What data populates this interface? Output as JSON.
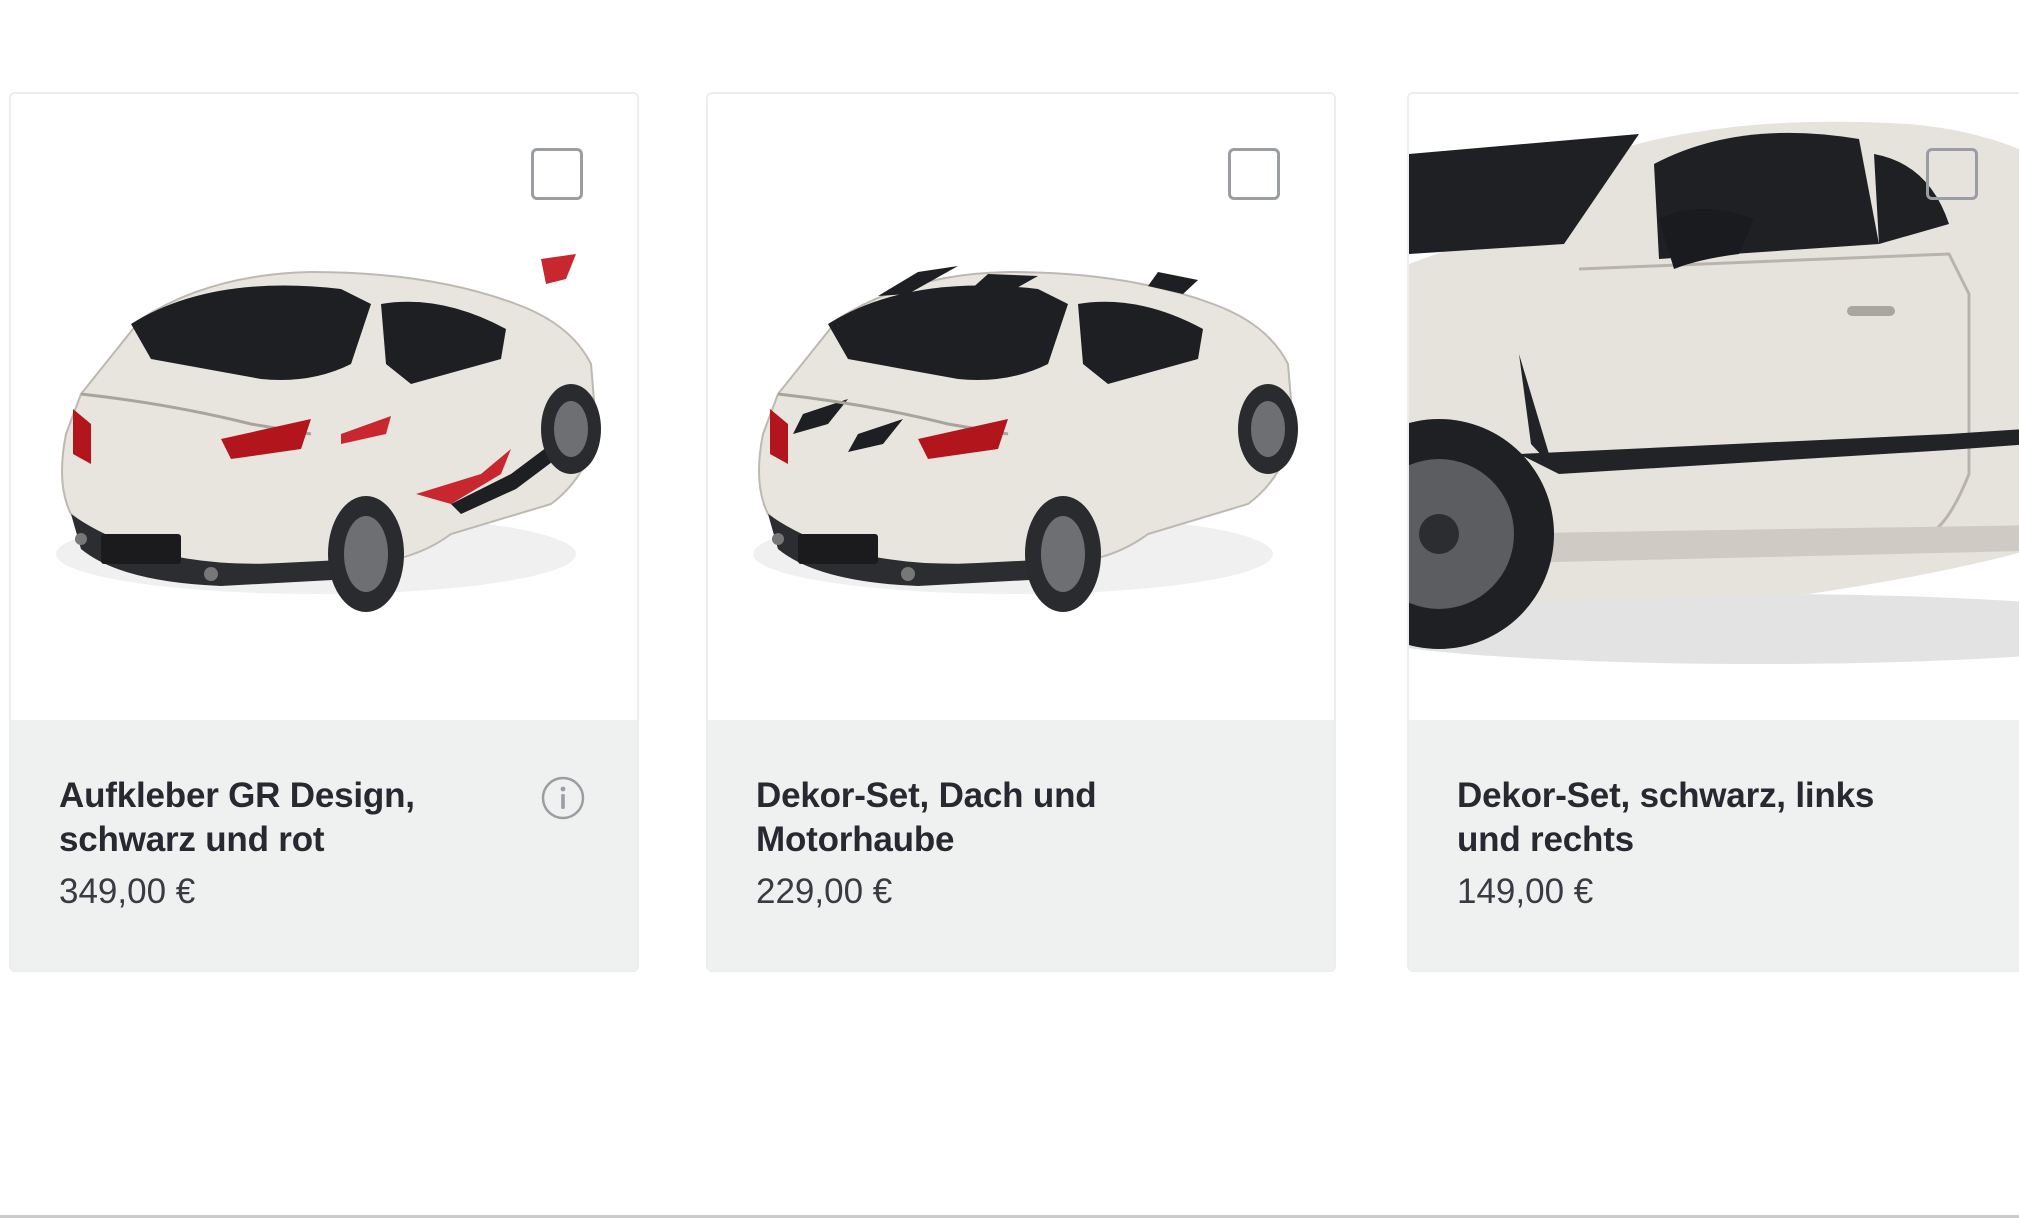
{
  "products": [
    {
      "title_line1": "Aufkleber GR Design,",
      "title_line2": "schwarz und rot",
      "price": "349,00 €",
      "has_info": true,
      "selected": false,
      "image": "car-rear-red-decals"
    },
    {
      "title_line1": "Dekor-Set, Dach und",
      "title_line2": "Motorhaube",
      "price": "229,00 €",
      "has_info": false,
      "selected": false,
      "image": "car-rear-black-stripes"
    },
    {
      "title_line1": "Dekor-Set, schwarz, links",
      "title_line2": "und rechts",
      "price": "149,00 €",
      "has_info": false,
      "selected": false,
      "image": "car-side-closeup"
    }
  ],
  "colors": {
    "info_bg": "#eff0f0",
    "text": "#282830",
    "accent_red": "#c8272f",
    "car_body": "#e8e5df"
  }
}
